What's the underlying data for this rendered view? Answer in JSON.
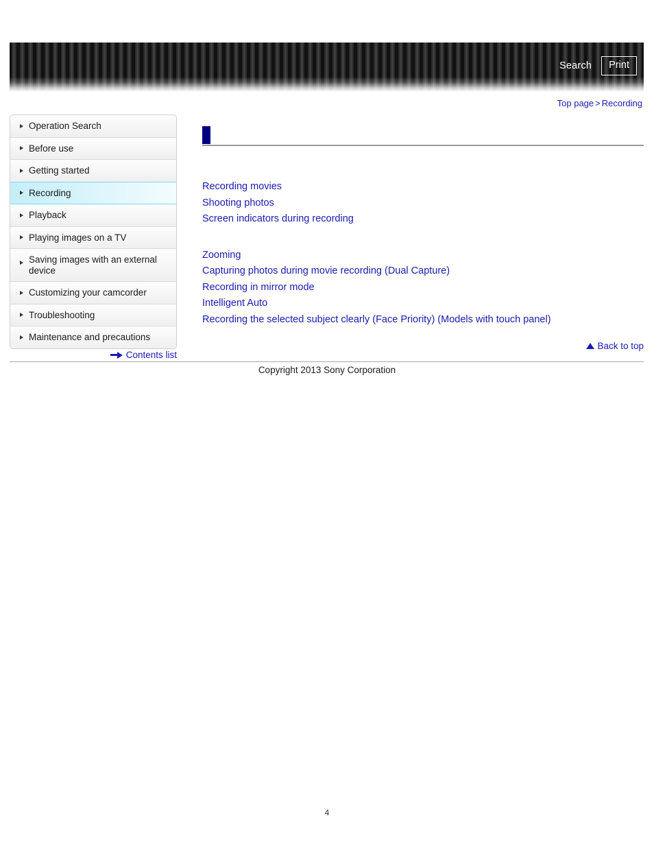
{
  "header": {
    "search_label": "Search",
    "print_label": "Print",
    "stripe_color_dark": "#111111",
    "stripe_color_light": "#3d3d3d"
  },
  "breadcrumb": {
    "root_label": "Top page",
    "separator": ">",
    "current_label": "Recording"
  },
  "sidebar": {
    "items": [
      {
        "label": "Operation Search",
        "active": false
      },
      {
        "label": "Before use",
        "active": false
      },
      {
        "label": "Getting started",
        "active": false
      },
      {
        "label": "Recording",
        "active": true
      },
      {
        "label": "Playback",
        "active": false
      },
      {
        "label": "Playing images on a TV",
        "active": false
      },
      {
        "label": "Saving images with an external device",
        "active": false
      },
      {
        "label": "Customizing your camcorder",
        "active": false
      },
      {
        "label": "Troubleshooting",
        "active": false
      },
      {
        "label": "Maintenance and precautions",
        "active": false
      }
    ],
    "contents_list_label": "Contents list",
    "active_color": "#7fd8ee"
  },
  "main": {
    "section_title": "",
    "marker_color": "#000080",
    "link_color": "#1a1ab0",
    "links_group_one": [
      "Recording movies",
      "Shooting photos",
      "Screen indicators during recording"
    ],
    "links_group_two": [
      "Zooming",
      "Capturing photos during movie recording (Dual Capture)",
      "Recording in mirror mode",
      "Intelligent Auto",
      "Recording the selected subject clearly (Face Priority) (Models with touch panel)"
    ],
    "back_to_top_label": "Back to top"
  },
  "footer": {
    "copyright": "Copyright 2013 Sony Corporation",
    "page_number": "4"
  }
}
